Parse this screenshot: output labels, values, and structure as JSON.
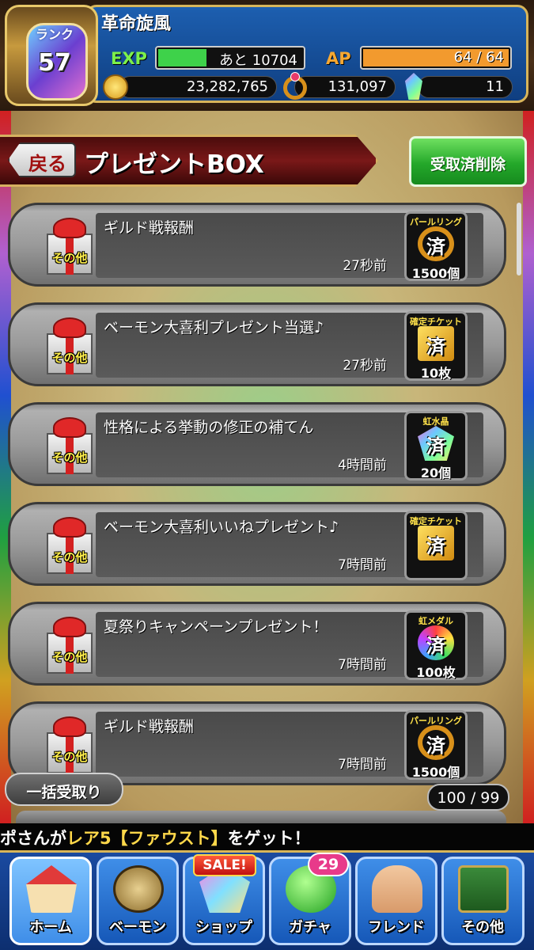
{
  "header": {
    "rank_label": "ランク",
    "rank": "57",
    "player_name": "革命旋風",
    "exp_label": "EXP",
    "exp_text": "あと 10704",
    "exp_progress": 0.35,
    "ap_label": "AP",
    "ap_text": "64 / 64",
    "ap_progress": 1.0,
    "gold": "23,282,765",
    "pearl_rings": "131,097",
    "rainbow_crystals": "11"
  },
  "title_bar": {
    "back_label": "戻る",
    "title": "プレゼントBOX",
    "delete_label": "受取済削除"
  },
  "gifts": [
    {
      "category": "その他",
      "title": "ギルド戦報酬",
      "time": "27秒前",
      "reward_name": "パールリング",
      "reward_icon": "pearl-ring-icon",
      "reward_status": "済",
      "reward_qty": "1500個"
    },
    {
      "category": "その他",
      "title": "ベーモン大喜利プレゼント当選♪",
      "time": "27秒前",
      "reward_name": "確定チケット",
      "reward_icon": "ticket-icon",
      "reward_status": "済",
      "reward_qty": "10枚"
    },
    {
      "category": "その他",
      "title": "性格による挙動の修正の補てん",
      "time": "4時間前",
      "reward_name": "虹水晶",
      "reward_icon": "rainbow-crystal-icon",
      "reward_status": "済",
      "reward_qty": "20個"
    },
    {
      "category": "その他",
      "title": "ベーモン大喜利いいねプレゼント♪",
      "time": "7時間前",
      "reward_name": "確定チケット",
      "reward_icon": "ticket-icon",
      "reward_status": "済",
      "reward_qty": ""
    },
    {
      "category": "その他",
      "title": "夏祭りキャンペーンプレゼント！",
      "time": "7時間前",
      "reward_name": "虹メダル",
      "reward_icon": "rainbow-medal-icon",
      "reward_status": "済",
      "reward_qty": "100枚"
    },
    {
      "category": "その他",
      "title": "ギルド戦報酬",
      "time": "7時間前",
      "reward_name": "パールリング",
      "reward_icon": "pearl-ring-icon",
      "reward_status": "済",
      "reward_qty": "1500個"
    }
  ],
  "footer": {
    "bulk_label": "一括受取り",
    "count": "100 / 99"
  },
  "ticker": {
    "prefix": "ポさんが",
    "highlight": "レア5【ファウスト】",
    "suffix": "をゲット！"
  },
  "nav": {
    "home": "ホーム",
    "bemon": "ベーモン",
    "shop": "ショップ",
    "shop_badge": "SALE!",
    "gacha": "ガチャ",
    "gacha_badge": "29",
    "friend": "フレンド",
    "other": "その他"
  },
  "colors": {
    "accent_green": "#24a82a",
    "header_blue": "#1d5fb0",
    "banner_red": "#7a1818",
    "gold_trim": "#d8b55a",
    "category_yellow": "#ffef4a"
  }
}
